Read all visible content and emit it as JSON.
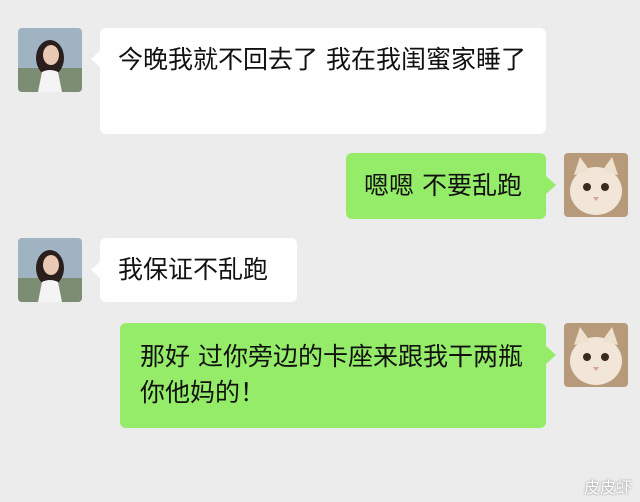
{
  "messages": [
    {
      "sender": "girl",
      "text": "今晚我就不回去了 我在我闺蜜家睡了"
    },
    {
      "sender": "me",
      "text": "嗯嗯 不要乱跑"
    },
    {
      "sender": "girl",
      "text": "我保证不乱跑"
    },
    {
      "sender": "me",
      "text": "那好 过你旁边的卡座来跟我干两瓶 你他妈的！"
    }
  ],
  "watermark": "皮皮虾",
  "colors": {
    "background": "#ececec",
    "incoming_bubble": "#ffffff",
    "outgoing_bubble": "#95ec69"
  }
}
